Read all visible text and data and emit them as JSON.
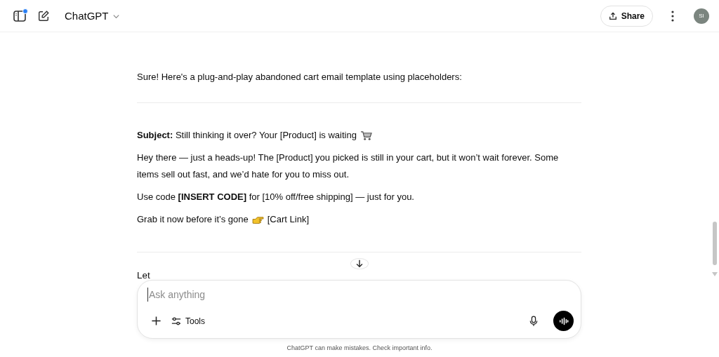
{
  "header": {
    "title": "ChatGPT",
    "share": "Share",
    "avatar": "SI",
    "notification": true
  },
  "message": {
    "intro": "Sure! Here's a plug-and-play abandoned cart email template using placeholders:",
    "email": [
      {
        "kind": "subject",
        "text": "**Subject:** Still thinking it over? Your [Product] is waiting"
      },
      {
        "kind": "para",
        "text": "Hey there — just a heads-up! The [Product] you picked is still in your cart, but it won’t wait forever. Some items sell out fast, and we’d hate for you to miss out."
      },
      {
        "kind": "para",
        "text": "Use code **[INSERT CODE]** for [10% off/free shipping] — just for you."
      },
      {
        "kind": "cta",
        "text": "Grab it now before it’s gone",
        "after": "[Cart Link]"
      }
    ],
    "cut_text": "Let"
  },
  "composer": {
    "placeholder": "Ask anything",
    "tools": "Tools"
  },
  "footer": "ChatGPT can make mistakes. Check important info."
}
